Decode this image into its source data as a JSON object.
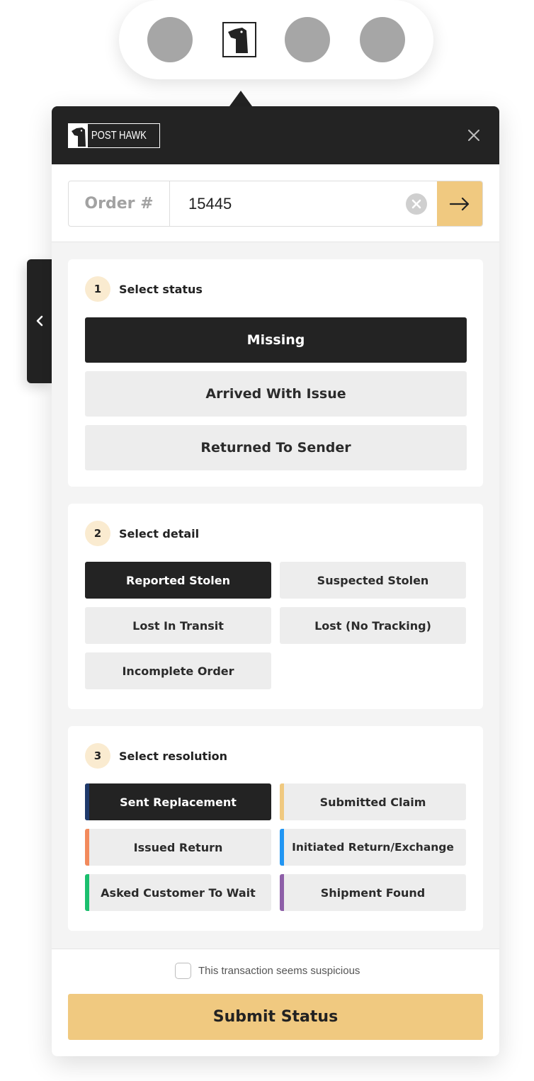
{
  "app": {
    "brand_text": "POST HAWK"
  },
  "order": {
    "label": "Order #",
    "value": "15445"
  },
  "sections": [
    {
      "step": "1",
      "title": "Select status",
      "options": [
        {
          "label": "Missing",
          "selected": true
        },
        {
          "label": "Arrived With Issue",
          "selected": false
        },
        {
          "label": "Returned To Sender",
          "selected": false
        }
      ]
    },
    {
      "step": "2",
      "title": "Select detail",
      "options": [
        {
          "label": "Reported Stolen",
          "selected": true
        },
        {
          "label": "Suspected Stolen",
          "selected": false
        },
        {
          "label": "Lost In Transit",
          "selected": false
        },
        {
          "label": "Lost (No Tracking)",
          "selected": false
        },
        {
          "label": "Incomplete Order",
          "selected": false
        }
      ]
    },
    {
      "step": "3",
      "title": "Select resolution",
      "options": [
        {
          "label": "Sent Replacement",
          "selected": true,
          "color": "#1f3a6b"
        },
        {
          "label": "Submitted Claim",
          "selected": false,
          "color": "#f0c980"
        },
        {
          "label": "Issued Return",
          "selected": false,
          "color": "#f28a5c"
        },
        {
          "label": "Initiated Return/Exchange",
          "selected": false,
          "color": "#2196f3"
        },
        {
          "label": "Asked Customer To Wait",
          "selected": false,
          "color": "#1bbf6e"
        },
        {
          "label": "Shipment Found",
          "selected": false,
          "color": "#8e5fa8"
        }
      ]
    }
  ],
  "footer": {
    "suspicious_label": "This transaction seems suspicious",
    "suspicious_checked": false,
    "submit_label": "Submit Status"
  },
  "colors": {
    "accent": "#f0c980",
    "dark": "#232323",
    "option_bg": "#ededed",
    "step_badge": "#faebd0"
  }
}
